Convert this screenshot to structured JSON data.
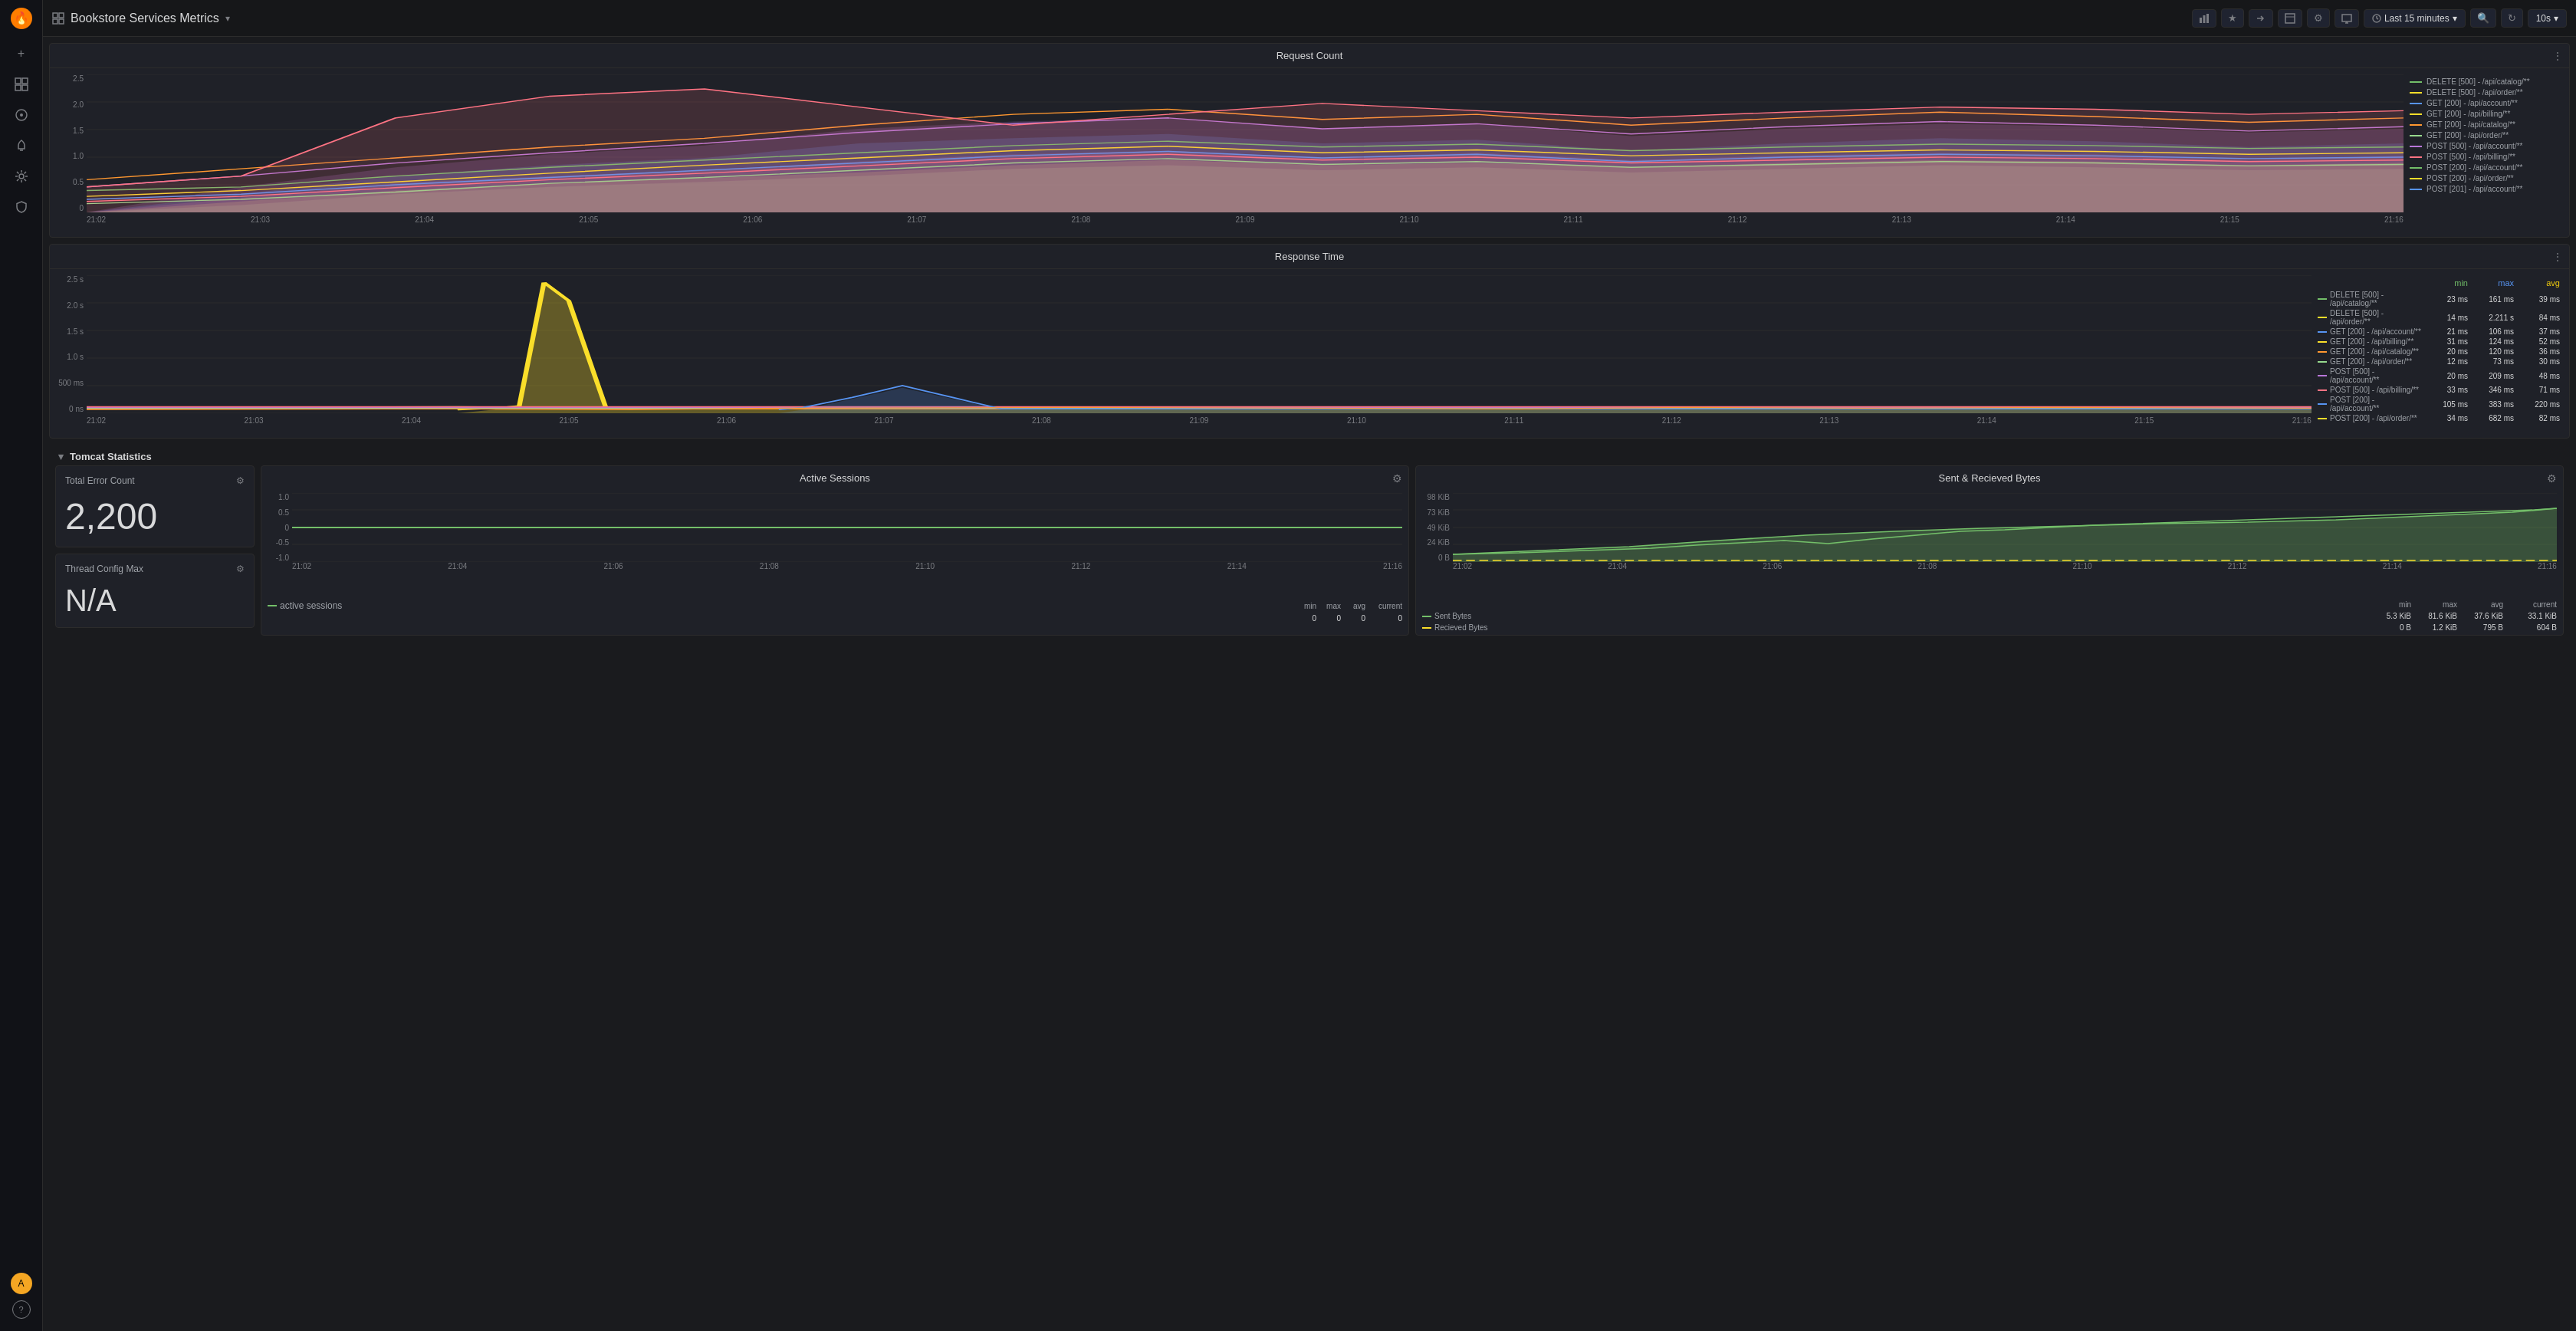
{
  "app": {
    "title": "Bookstore Services Metrics",
    "logo_icon": "🔥"
  },
  "topbar": {
    "title": "Bookstore Services Metrics",
    "dropdown_icon": "▾",
    "time_range": "Last 15 minutes",
    "refresh": "10s"
  },
  "sidebar": {
    "icons": [
      {
        "name": "add",
        "symbol": "+",
        "active": false
      },
      {
        "name": "grid",
        "symbol": "⊞",
        "active": false
      },
      {
        "name": "compass",
        "symbol": "◎",
        "active": false
      },
      {
        "name": "bell",
        "symbol": "🔔",
        "active": false
      },
      {
        "name": "settings",
        "symbol": "⚙",
        "active": false
      },
      {
        "name": "shield",
        "symbol": "🛡",
        "active": false
      }
    ],
    "bottom_icons": [
      {
        "name": "avatar",
        "symbol": "A"
      },
      {
        "name": "help",
        "symbol": "?"
      }
    ]
  },
  "request_count": {
    "title": "Request Count",
    "y_axis": [
      "2.5",
      "2.0",
      "1.5",
      "1.0",
      "0.5",
      "0"
    ],
    "x_axis": [
      "21:02",
      "21:03",
      "21:04",
      "21:05",
      "21:06",
      "21:07",
      "21:08",
      "21:09",
      "21:10",
      "21:11",
      "21:12",
      "21:13",
      "21:14",
      "21:15",
      "21:16"
    ],
    "legend": [
      {
        "label": "DELETE [500] - /api/catalog/**",
        "color": "#73bf69"
      },
      {
        "label": "DELETE [500] - /api/order/**",
        "color": "#fade2a"
      },
      {
        "label": "GET [200] - /api/account/**",
        "color": "#5794f2"
      },
      {
        "label": "GET [200] - /api/billing/**",
        "color": "#fade2a"
      },
      {
        "label": "GET [200] - /api/catalog/**",
        "color": "#ff9830"
      },
      {
        "label": "GET [200] - /api/order/**",
        "color": "#96d98d"
      },
      {
        "label": "POST [500] - /api/account/**",
        "color": "#b877d9"
      },
      {
        "label": "POST [500] - /api/billing/**",
        "color": "#ff7383"
      },
      {
        "label": "POST [200] - /api/account/**",
        "color": "#73bf69"
      },
      {
        "label": "POST [200] - /api/order/**",
        "color": "#fade2a"
      },
      {
        "label": "POST [201] - /api/account/**",
        "color": "#5794f2"
      }
    ]
  },
  "response_time": {
    "title": "Response Time",
    "y_axis": [
      "2.5 s",
      "2.0 s",
      "1.5 s",
      "1.0 s",
      "500 ms",
      "0 ns"
    ],
    "x_axis": [
      "21:02",
      "21:03",
      "21:04",
      "21:05",
      "21:06",
      "21:07",
      "21:08",
      "21:09",
      "21:10",
      "21:11",
      "21:12",
      "21:13",
      "21:14",
      "21:15",
      "21:16"
    ],
    "legend_header": {
      "min": "min",
      "max": "max",
      "avg": "avg"
    },
    "legend": [
      {
        "label": "DELETE [500] - /api/catalog/**",
        "color": "#73bf69",
        "min": "23 ms",
        "max": "161 ms",
        "avg": "39 ms"
      },
      {
        "label": "DELETE [500] - /api/order/**",
        "color": "#fade2a",
        "min": "14 ms",
        "max": "2.211 s",
        "avg": "84 ms"
      },
      {
        "label": "GET [200] - /api/account/**",
        "color": "#5794f2",
        "min": "21 ms",
        "max": "106 ms",
        "avg": "37 ms"
      },
      {
        "label": "GET [200] - /api/billing/**",
        "color": "#fade2a",
        "min": "31 ms",
        "max": "124 ms",
        "avg": "52 ms"
      },
      {
        "label": "GET [200] - /api/catalog/**",
        "color": "#ff9830",
        "min": "20 ms",
        "max": "120 ms",
        "avg": "36 ms"
      },
      {
        "label": "GET [200] - /api/order/**",
        "color": "#96d98d",
        "min": "12 ms",
        "max": "73 ms",
        "avg": "30 ms"
      },
      {
        "label": "POST [500] - /api/account/**",
        "color": "#b877d9",
        "min": "20 ms",
        "max": "209 ms",
        "avg": "48 ms"
      },
      {
        "label": "POST [500] - /api/billing/**",
        "color": "#ff7383",
        "min": "33 ms",
        "max": "346 ms",
        "avg": "71 ms"
      },
      {
        "label": "POST [200] - /api/account/**",
        "color": "#5794f2",
        "min": "105 ms",
        "max": "383 ms",
        "avg": "220 ms"
      },
      {
        "label": "POST [200] - /api/order/**",
        "color": "#fade2a",
        "min": "34 ms",
        "max": "682 ms",
        "avg": "82 ms"
      }
    ]
  },
  "tomcat": {
    "section_title": "Tomcat Statistics",
    "total_error_count": {
      "title": "Total Error Count",
      "value": "2,200"
    },
    "thread_config_max": {
      "title": "Thread Config Max",
      "value": "N/A"
    },
    "active_sessions": {
      "title": "Active Sessions",
      "y_axis": [
        "1.0",
        "0.5",
        "0",
        "-0.5",
        "-1.0"
      ],
      "x_axis": [
        "21:02",
        "21:04",
        "21:06",
        "21:08",
        "21:10",
        "21:12",
        "21:14",
        "21:16"
      ],
      "legend": [
        {
          "label": "active sessions",
          "color": "#73bf69"
        }
      ],
      "stats": {
        "min": "0",
        "max": "0",
        "avg": "0",
        "current": "0"
      }
    },
    "sent_received_bytes": {
      "title": "Sent & Recieved Bytes",
      "y_axis": [
        "98 KiB",
        "73 KiB",
        "49 KiB",
        "24 KiB",
        "0 B"
      ],
      "x_axis": [
        "21:02",
        "21:04",
        "21:06",
        "21:08",
        "21:10",
        "21:12",
        "21:14",
        "21:16"
      ],
      "legend": [
        {
          "label": "Sent Bytes",
          "color": "#73bf69"
        },
        {
          "label": "Recieved Bytes",
          "color": "#fade2a"
        }
      ],
      "stats": {
        "sent": {
          "min": "5.3 KiB",
          "max": "81.6 KiB",
          "avg": "37.6 KiB",
          "current": "33.1 KiB"
        },
        "received": {
          "min": "0 B",
          "max": "1.2 KiB",
          "avg": "795 B",
          "current": "604 B"
        }
      }
    }
  }
}
